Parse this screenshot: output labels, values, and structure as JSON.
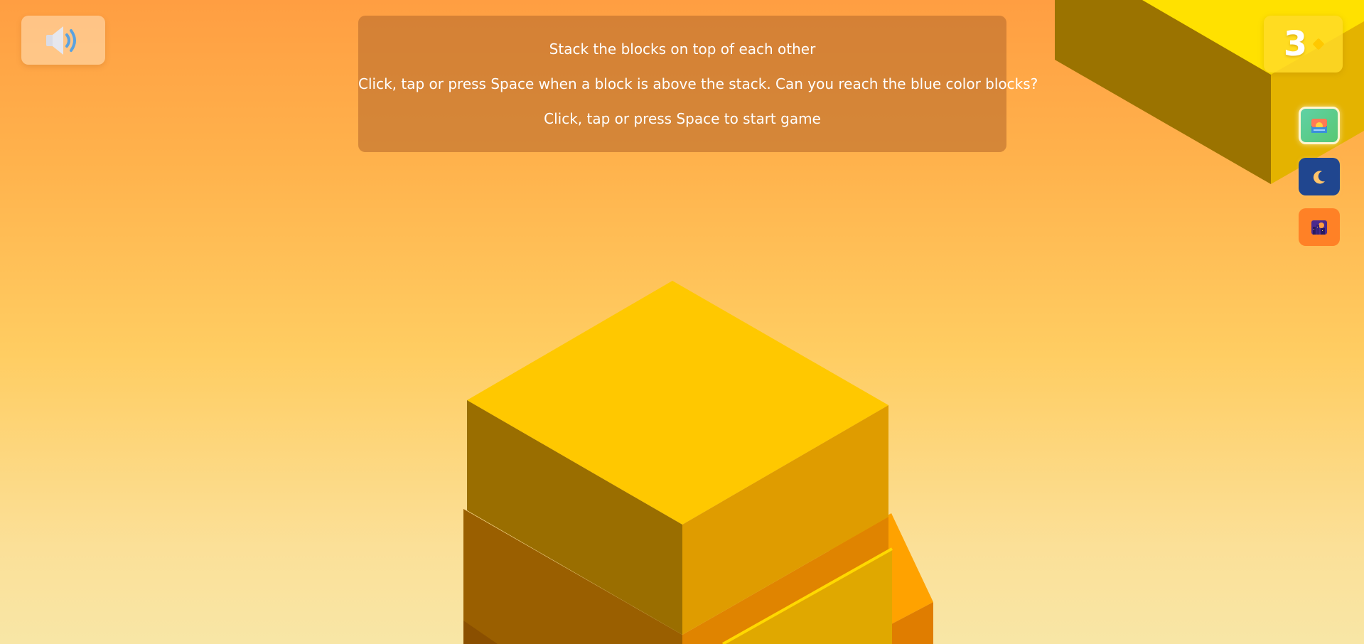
{
  "sound_button": {
    "icon": "speaker-volume-icon"
  },
  "instructions": {
    "line1": "Stack the blocks on top of each other",
    "line2": "Click, tap or press Space when a block is above the stack. Can you reach the blue color blocks?",
    "line3": "Click, tap or press Space to start game"
  },
  "score": {
    "value": "3",
    "icon": "gem-icon"
  },
  "themes": [
    {
      "name": "day-theme",
      "icon": "sunrise-icon",
      "color": "#58c873",
      "selected": true
    },
    {
      "name": "night-theme",
      "icon": "moon-icon",
      "color": "#20468f",
      "selected": false
    },
    {
      "name": "sunset-theme",
      "icon": "sunset-city-icon",
      "color": "#ff8126",
      "selected": false
    }
  ],
  "colors": {
    "background_top": "#ff9e42",
    "background_bottom": "#f8e6a6",
    "block_top": "#ffc800",
    "block_left": "#9a6e00",
    "block_right": "#df9c00"
  }
}
